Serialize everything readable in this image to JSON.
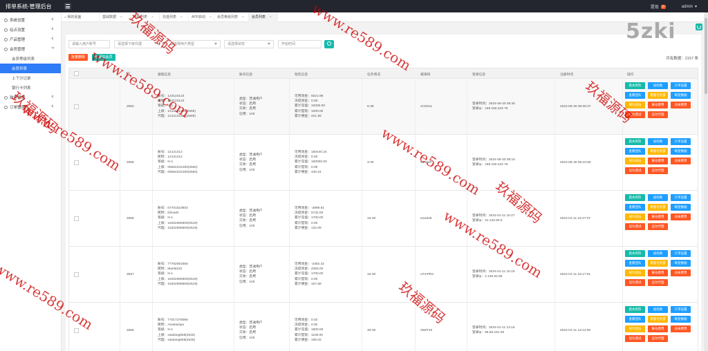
{
  "app": {
    "title": "排单系统-管理后台",
    "top_right_label": "提现",
    "top_right_badge": "0",
    "user": "admin"
  },
  "sidebar": {
    "items": [
      {
        "label": "系统设置",
        "icon": "gear-icon"
      },
      {
        "label": "站点设置",
        "icon": "globe-icon"
      },
      {
        "label": "产品管理",
        "icon": "box-icon"
      },
      {
        "label": "会员管理",
        "icon": "user-icon"
      }
    ],
    "sub_items": [
      {
        "label": "会员等级列表",
        "active": false
      },
      {
        "label": "会员列表",
        "active": true
      },
      {
        "label": "上下分记录",
        "active": false
      },
      {
        "label": "银行卡列表",
        "active": false
      }
    ],
    "bottom_items": [
      {
        "label": "财务管理",
        "icon": "wallet-icon"
      },
      {
        "label": "订单管理",
        "icon": "order-icon"
      }
    ]
  },
  "tabs": [
    {
      "label": "我的桌面",
      "closable": false
    },
    {
      "label": "基础数据",
      "closable": true
    },
    {
      "label": "审核列表",
      "closable": true
    },
    {
      "label": "充值列表",
      "closable": true
    },
    {
      "label": "APP启动",
      "closable": true
    },
    {
      "label": "会员等级列表",
      "closable": true
    },
    {
      "label": "会员列表",
      "closable": true
    }
  ],
  "filters": {
    "user_placeholder": "请输入用户账号",
    "agent_select": "请选择下级代理",
    "type_select": "请选择用户类型",
    "status_select": "请选择状态",
    "date_placeholder": "开始时间"
  },
  "actions": {
    "batch_delete": "批量删除",
    "add_member": "添加会员"
  },
  "total": "共有数据：2157 条",
  "columns": [
    "ID",
    "基础信息",
    "账号信息",
    "钱包信息",
    "任务情况",
    "邀请码",
    "登录信息",
    "注册时间",
    "操作"
  ],
  "op_buttons": [
    {
      "label": "基本资料",
      "color": "green"
    },
    {
      "label": "加扣款",
      "color": "blue"
    },
    {
      "label": "订单设置",
      "color": "blue"
    },
    {
      "label": "查看团队",
      "color": "blue"
    },
    {
      "label": "重置任务量",
      "color": "orange"
    },
    {
      "label": "每变数据",
      "color": "blue"
    },
    {
      "label": "钱包地址",
      "color": "orange"
    },
    {
      "label": "账号费用",
      "color": "red"
    },
    {
      "label": "去掉费用",
      "color": "red"
    },
    {
      "label": "设为测试",
      "color": "red"
    },
    {
      "label": "设为代理",
      "color": "red"
    }
  ],
  "rows": [
    {
      "id": "2560",
      "basic": [
        "账号：123123123",
        "昵称：123123123",
        "等级：N-1",
        "上级：1212121212(2559)",
        "代理：1212121212(2559)"
      ],
      "account": [
        "类型：普通用户",
        "状态：启用",
        "交易：启用",
        "信用：100"
      ],
      "wallet": [
        "可用资金：9221.98",
        "冻结资金：0.00",
        "累计充值：10000.00",
        "累计提现：1000.00",
        "累计佣金：221.98"
      ],
      "task": "6-38",
      "invite": "vCD0ox",
      "login": [
        "登录时间：2024-06-30 08:36",
        "登录ip：169.150.222.76"
      ],
      "reg": "2024-06-30 08:36:37"
    },
    {
      "id": "2559",
      "basic": [
        "账号：12121212",
        "昵称：12121212",
        "等级：N-1",
        "上级：05564234180(2550)",
        "代理：05564234180(2550)"
      ],
      "account": [
        "类型：普通用户",
        "状态：启用",
        "交易：启用",
        "信用：100"
      ],
      "wallet": [
        "可用资金：160440.24",
        "冻结资金：0.00",
        "累计充值：160000.00",
        "累计提现：0.00",
        "累计佣金：440.24"
      ],
      "task": "3-30",
      "invite": "9d42uP",
      "login": [
        "登录时间：2024-06-30 08:15",
        "登录ip：169.150.222.76"
      ],
      "reg": "2024-06-30 08:10:50"
    },
    {
      "id": "2558",
      "basic": [
        "账号：07701523803",
        "昵称：Dimash",
        "等级：N-1",
        "上级：15202595909(2519)",
        "代理：15202595909(2519)"
      ],
      "account": [
        "类型：普通用户",
        "状态：启用",
        "交易：启用",
        "信用：100"
      ],
      "wallet": [
        "可用资金：-3899.91",
        "冻结资金：5732.00",
        "累计充值：1700.00",
        "累计提现：0.00",
        "累计佣金：132.09"
      ],
      "task": "15-30",
      "invite": "wza32K",
      "login": [
        "登录时间：2024-01-11 15:27",
        "登录ip：31.132.80.0"
      ],
      "reg": "2024-01-11 15:27:07"
    },
    {
      "id": "2557",
      "basic": [
        "账号：77752061565",
        "昵称：Marlal222",
        "等级：N-1",
        "上级：15202595909(2519)",
        "代理：15202595909(2519)"
      ],
      "account": [
        "类型：普通用户",
        "状态：启用",
        "交易：启用",
        "信用：100"
      ],
      "wallet": [
        "可用资金：-2482.42",
        "冻结资金：4350.00",
        "累计充值：1700.00",
        "累计提现：0.00",
        "累计佣金：167.58"
      ],
      "task": "15-30",
      "invite": "uTmPR3",
      "login": [
        "登录时间：2024-01-11 15:18",
        "登录ip：2.135.64.86"
      ],
      "reg": "2024-01-11 15:17:51"
    },
    {
      "id": "2555",
      "basic": [
        "账号：77017278066",
        "昵称：Anastasiya",
        "等级：N-1",
        "上级：xiaolang668(2526)",
        "代理：xiaolang668(2526)"
      ],
      "account": [
        "类型：普通用户",
        "状态：启用",
        "交易：启用",
        "信用：100"
      ],
      "wallet": [
        "可用资金：0.02",
        "冻结资金：0.00",
        "累计充值：1800.00",
        "累计提现：1105.00",
        "累计佣金：185.02"
      ],
      "task": "30-30",
      "invite": "z5MTJ9",
      "login": [
        "登录时间：2024-01-11 13:16",
        "登录ip：95.56.181.26"
      ],
      "reg": "2024-01-11 13:14:00"
    }
  ],
  "watermarks": {
    "site": "www.re589.com",
    "cn": "玖福源码",
    "logo": "5zki"
  }
}
